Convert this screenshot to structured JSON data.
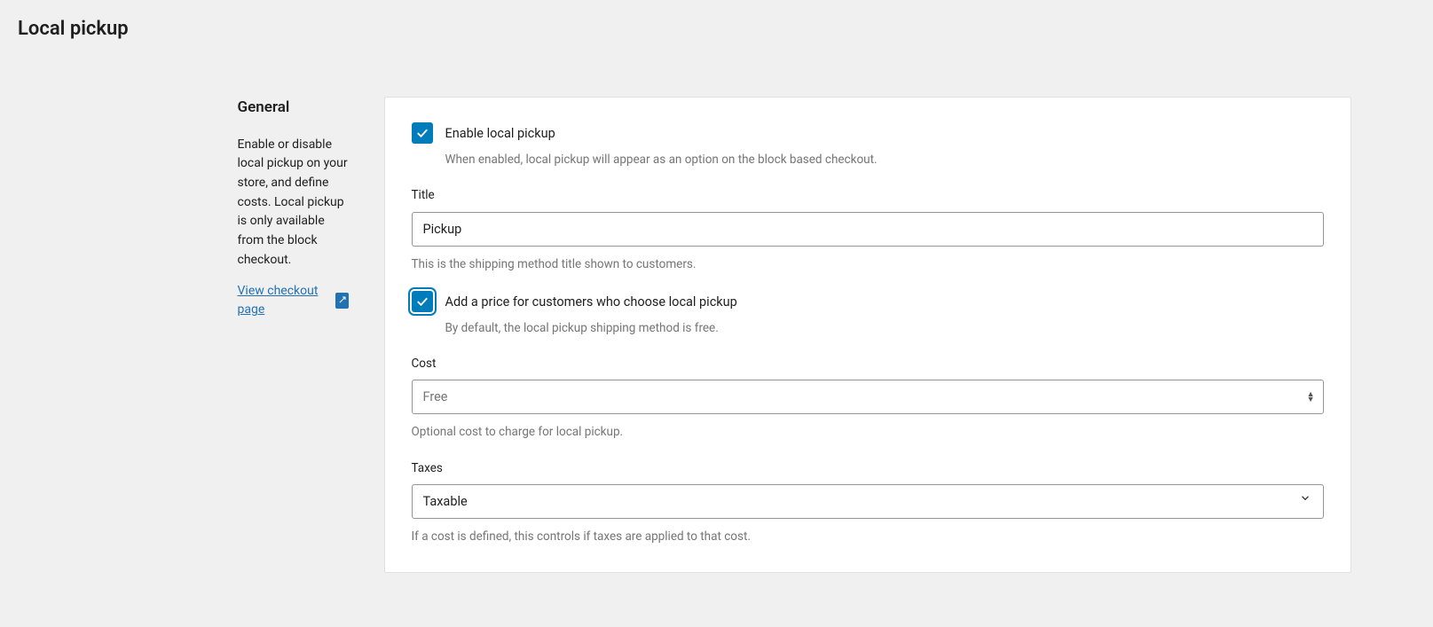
{
  "page": {
    "title": "Local pickup"
  },
  "sidebar": {
    "heading": "General",
    "description": "Enable or disable local pickup on your store, and define costs. Local pickup is only available from the block checkout.",
    "link_text": "View checkout page"
  },
  "form": {
    "enable": {
      "label": "Enable local pickup",
      "helper": "When enabled, local pickup will appear as an option on the block based checkout."
    },
    "title_field": {
      "label": "Title",
      "value": "Pickup",
      "helper": "This is the shipping method title shown to customers."
    },
    "add_price": {
      "label": "Add a price for customers who choose local pickup",
      "helper": "By default, the local pickup shipping method is free."
    },
    "cost": {
      "label": "Cost",
      "placeholder": "Free",
      "helper": "Optional cost to charge for local pickup."
    },
    "taxes": {
      "label": "Taxes",
      "value": "Taxable",
      "helper": "If a cost is defined, this controls if taxes are applied to that cost."
    }
  }
}
